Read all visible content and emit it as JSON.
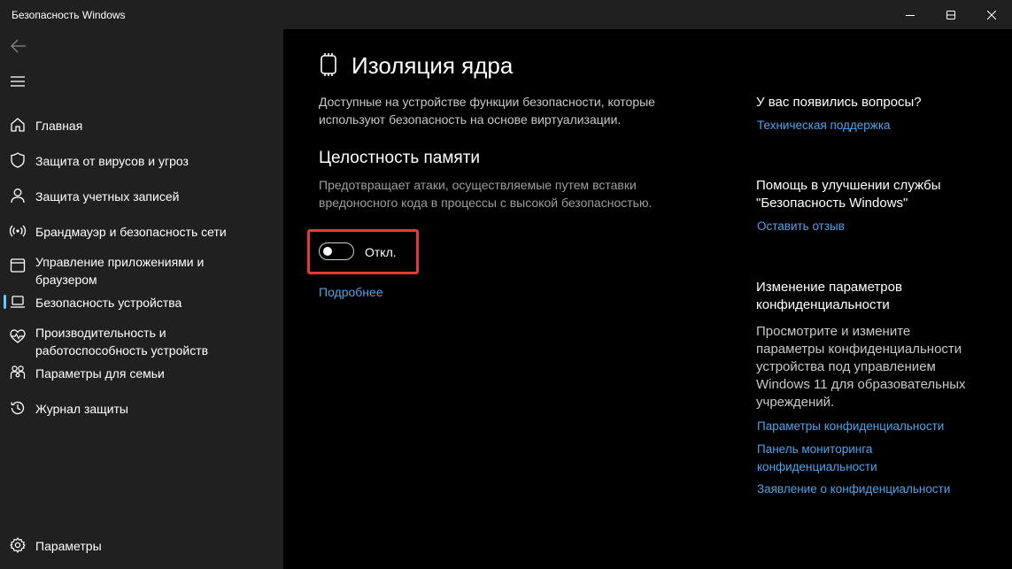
{
  "window": {
    "title": "Безопасность Windows"
  },
  "sidebar": {
    "items": [
      {
        "label": "Главная",
        "icon": "home-icon"
      },
      {
        "label": "Защита от вирусов и угроз",
        "icon": "shield-icon"
      },
      {
        "label": "Защита учетных записей",
        "icon": "person-icon"
      },
      {
        "label": "Брандмауэр и безопасность сети",
        "icon": "wireless-icon"
      },
      {
        "label": "Управление приложениями и браузером",
        "icon": "app-browser-icon"
      },
      {
        "label": "Безопасность устройства",
        "icon": "laptop-icon",
        "selected": true
      },
      {
        "label": "Производительность и работоспособность устройств",
        "icon": "heart-pulse-icon"
      },
      {
        "label": "Параметры для семьи",
        "icon": "family-icon"
      },
      {
        "label": "Журнал защиты",
        "icon": "history-icon"
      }
    ],
    "settings_label": "Параметры"
  },
  "main": {
    "title": "Изоляция ядра",
    "description": "Доступные на устройстве функции безопасности, которые используют безопасность на основе виртуализации.",
    "section": {
      "title": "Целостность памяти",
      "description": "Предотвращает атаки, осуществляемые путем вставки вредоносного кода в процессы с высокой безопасностью.",
      "toggle_state_label": "Откл.",
      "toggle_on": false,
      "learn_more": "Подробнее"
    }
  },
  "side_panel": {
    "questions_heading": "У вас появились вопросы?",
    "support_link": "Техническая поддержка",
    "improve_heading": "Помощь в улучшении службы \"Безопасность Windows\"",
    "feedback_link": "Оставить отзыв",
    "privacy_heading": "Изменение параметров конфиденциальности",
    "privacy_text": "Просмотрите и измените параметры конфиденциальности устройства под управлением Windows 11 для образовательных учреждений.",
    "privacy_links": [
      "Параметры конфиденциальности",
      "Панель мониторинга конфиденциальности",
      "Заявление о конфиденциальности"
    ]
  },
  "colors": {
    "accent": "#60cdff",
    "link": "#4ea3e8",
    "highlight_border": "#e5383b",
    "sidebar_bg": "#202020",
    "main_bg": "#000000"
  }
}
